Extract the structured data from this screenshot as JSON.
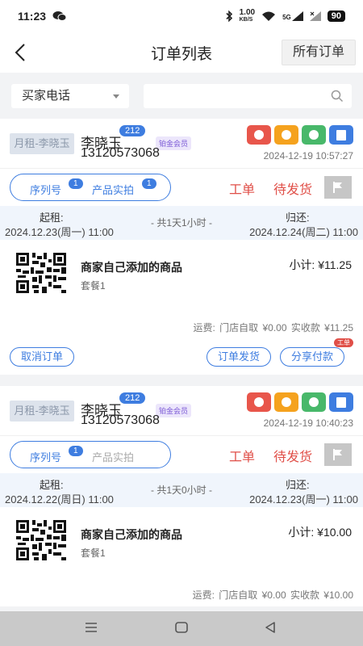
{
  "status_bar": {
    "time": "11:23",
    "network_speed": "1.00",
    "network_unit": "KB/S",
    "signal": "5G",
    "battery": "90"
  },
  "header": {
    "title": "订单列表",
    "all_orders_label": "所有订单"
  },
  "filter": {
    "search_type": "买家电话",
    "search_placeholder": ""
  },
  "orders": [
    {
      "rent_tag": "月租-李晓玉",
      "buyer_name": "李晓玉",
      "order_count": "212",
      "member_level": "铂金会员",
      "phone": "13120573068",
      "time": "2024-12-19 10:57:27",
      "serial_label": "序列号",
      "serial_count": "1",
      "photo_label": "产品实拍",
      "photo_count": "1",
      "work_order_label": "工单",
      "status": "待发货",
      "rent_start_label": "起租:",
      "rent_start": "2024.12.23(周一) 11:00",
      "duration": "- 共1天1小时 -",
      "rent_end_label": "归还:",
      "rent_end": "2024.12.24(周二) 11:00",
      "product_name": "商家自己添加的商品",
      "package": "套餐1",
      "subtotal": "小计: ¥11.25",
      "summary": "运费: 门店自取 ¥0.00  实收款 ¥11.25",
      "actions": {
        "cancel": "取消订单",
        "ship": "订单发货",
        "share": "分享付款",
        "share_badge": "工单"
      }
    },
    {
      "rent_tag": "月租-李晓玉",
      "buyer_name": "李晓玉",
      "order_count": "212",
      "member_level": "铂金会员",
      "phone": "13120573068",
      "time": "2024-12-19 10:40:23",
      "serial_label": "序列号",
      "serial_count": "1",
      "photo_label": "产品实拍",
      "work_order_label": "工单",
      "status": "待发货",
      "rent_start_label": "起租:",
      "rent_start": "2024.12.22(周日) 11:00",
      "duration": "- 共1天0小时 -",
      "rent_end_label": "归还:",
      "rent_end": "2024.12.23(周一) 11:00",
      "product_name": "商家自己添加的商品",
      "package": "套餐1",
      "subtotal": "小计: ¥10.00",
      "summary": "运费: 门店自取 ¥0.00  实收款 ¥10.00"
    }
  ]
}
